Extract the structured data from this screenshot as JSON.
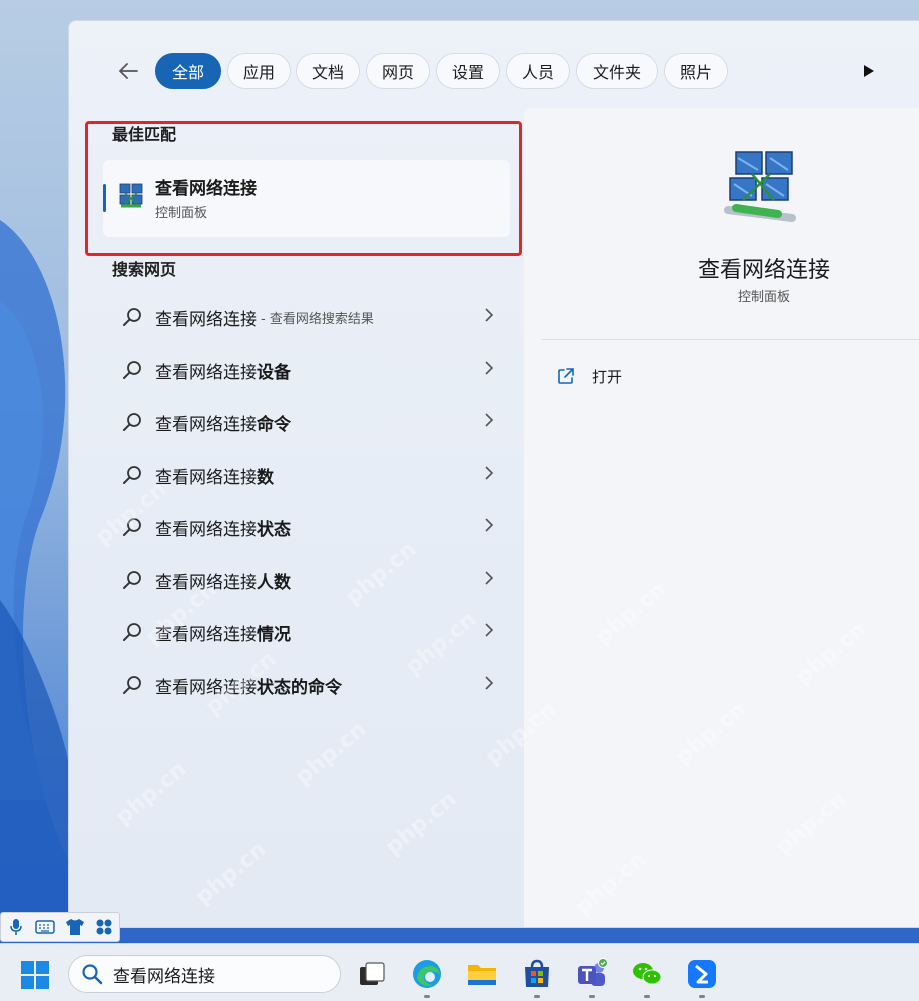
{
  "filters": {
    "back_icon": "back-arrow-icon",
    "chips": [
      {
        "label": "全部",
        "active": true
      },
      {
        "label": "应用",
        "active": false
      },
      {
        "label": "文档",
        "active": false
      },
      {
        "label": "网页",
        "active": false
      },
      {
        "label": "设置",
        "active": false
      },
      {
        "label": "人员",
        "active": false
      },
      {
        "label": "文件夹",
        "active": false
      },
      {
        "label": "照片",
        "active": false
      }
    ],
    "more_icon": "play-triangle-icon"
  },
  "best_match": {
    "section_title": "最佳匹配",
    "title": "查看网络连接",
    "subtitle": "控制面板",
    "icon": "network-connections-icon"
  },
  "web_search": {
    "section_title": "搜索网页",
    "items": [
      {
        "prefix": "查看网络连接",
        "bold": "",
        "hint": "- 查看网络搜索结果"
      },
      {
        "prefix": "查看网络连接",
        "bold": "设备",
        "hint": ""
      },
      {
        "prefix": "查看网络连接",
        "bold": "命令",
        "hint": ""
      },
      {
        "prefix": "查看网络连接",
        "bold": "数",
        "hint": ""
      },
      {
        "prefix": "查看网络连接",
        "bold": "状态",
        "hint": ""
      },
      {
        "prefix": "查看网络连接",
        "bold": "人数",
        "hint": ""
      },
      {
        "prefix": "查看网络连接",
        "bold": "情况",
        "hint": ""
      },
      {
        "prefix": "查看网络连接",
        "bold": "状态的命令",
        "hint": ""
      }
    ]
  },
  "detail": {
    "name": "查看网络连接",
    "type": "控制面板",
    "actions": [
      {
        "label": "打开",
        "icon": "open-external-icon"
      }
    ]
  },
  "taskbar": {
    "search_value": "查看网络连接",
    "apps": [
      "task-view-icon",
      "edge-icon",
      "file-explorer-icon",
      "microsoft-store-icon",
      "teams-icon",
      "wechat-icon",
      "feishu-icon"
    ]
  },
  "watermark": "php.cn",
  "colors": {
    "accent": "#1765b5",
    "highlight_box": "#e0262b"
  }
}
